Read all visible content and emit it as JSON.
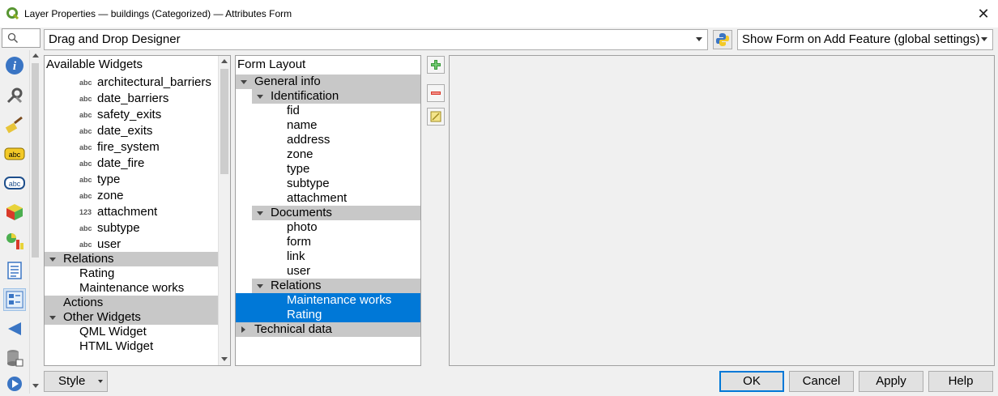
{
  "window": {
    "title": "Layer Properties — buildings (Categorized) — Attributes Form",
    "close_glyph": "✕"
  },
  "sidebar": {
    "search_icon": "search-icon",
    "icons": [
      "information-icon",
      "source-icon",
      "symbology-icon",
      "labels-icon",
      "masks-icon",
      "3d-view-icon",
      "diagrams-icon",
      "fields-icon",
      "attributes-form-icon",
      "joins-icon",
      "auxiliary-storage-icon",
      "actions-icon"
    ]
  },
  "toolbar": {
    "designer_mode": "Drag and Drop Designer",
    "python_icon": "python-icon",
    "show_form_option": "Show Form on Add Feature (global settings)"
  },
  "available_widgets": {
    "header": "Available Widgets",
    "fields": [
      {
        "type": "abc",
        "name": "architectural_barriers"
      },
      {
        "type": "abc",
        "name": "date_barriers"
      },
      {
        "type": "abc",
        "name": "safety_exits"
      },
      {
        "type": "abc",
        "name": "date_exits"
      },
      {
        "type": "abc",
        "name": "fire_system"
      },
      {
        "type": "abc",
        "name": "date_fire"
      },
      {
        "type": "abc",
        "name": "type"
      },
      {
        "type": "abc",
        "name": "zone"
      },
      {
        "type": "123",
        "name": "attachment"
      },
      {
        "type": "abc",
        "name": "subtype"
      },
      {
        "type": "abc",
        "name": "user"
      }
    ],
    "relations_label": "Relations",
    "relations": [
      "Rating",
      "Maintenance works"
    ],
    "actions_label": "Actions",
    "other_label": "Other Widgets",
    "other": [
      "QML Widget",
      "HTML Widget"
    ]
  },
  "form_layout": {
    "header": "Form Layout",
    "general_info": "General info",
    "identification": "Identification",
    "identification_fields": [
      "fid",
      "name",
      "address",
      "zone",
      "type",
      "subtype",
      "attachment"
    ],
    "documents": "Documents",
    "documents_fields": [
      "photo",
      "form",
      "link",
      "user"
    ],
    "relations": "Relations",
    "relations_items": [
      "Maintenance works",
      "Rating"
    ],
    "technical_data": "Technical data"
  },
  "side_buttons": [
    "add-container-icon",
    "remove-icon",
    "edit-icon"
  ],
  "footer": {
    "style": "Style",
    "ok": "OK",
    "cancel": "Cancel",
    "apply": "Apply",
    "help": "Help"
  },
  "colors": {
    "selection": "#0078d7",
    "group_band": "#c8c8c8"
  }
}
